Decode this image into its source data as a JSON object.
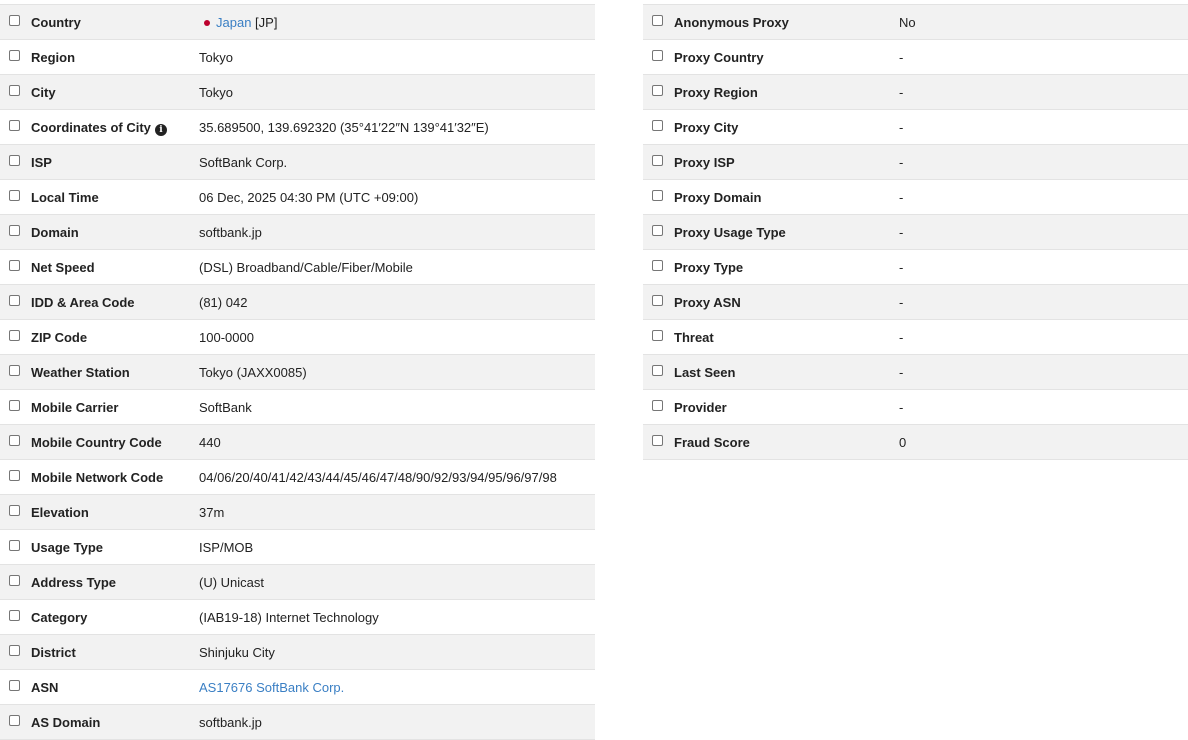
{
  "left_rows": [
    {
      "label": "Country",
      "value": "Japan",
      "suffix": " [JP]",
      "link": true,
      "flag": true
    },
    {
      "label": "Region",
      "value": "Tokyo"
    },
    {
      "label": "City",
      "value": "Tokyo"
    },
    {
      "label": "Coordinates of City",
      "value": "35.689500, 139.692320 (35°41′22″N   139°41′32″E)",
      "info": true
    },
    {
      "label": "ISP",
      "value": "SoftBank Corp."
    },
    {
      "label": "Local Time",
      "value": "06 Dec, 2025 04:30 PM (UTC +09:00)"
    },
    {
      "label": "Domain",
      "value": "softbank.jp"
    },
    {
      "label": "Net Speed",
      "value": "(DSL) Broadband/Cable/Fiber/Mobile"
    },
    {
      "label": "IDD & Area Code",
      "value": "(81) 042"
    },
    {
      "label": "ZIP Code",
      "value": "100-0000"
    },
    {
      "label": "Weather Station",
      "value": "Tokyo (JAXX0085)"
    },
    {
      "label": "Mobile Carrier",
      "value": "SoftBank"
    },
    {
      "label": "Mobile Country Code",
      "value": "440"
    },
    {
      "label": "Mobile Network Code",
      "value": "04/06/20/40/41/42/43/44/45/46/47/48/90/92/93/94/95/96/97/98"
    },
    {
      "label": "Elevation",
      "value": "37m"
    },
    {
      "label": "Usage Type",
      "value": "ISP/MOB"
    },
    {
      "label": "Address Type",
      "value": "(U) Unicast"
    },
    {
      "label": "Category",
      "value": "(IAB19-18) Internet Technology"
    },
    {
      "label": "District",
      "value": "Shinjuku City"
    },
    {
      "label": "ASN",
      "value": "AS17676 SoftBank Corp.",
      "link": true
    },
    {
      "label": "AS Domain",
      "value": "softbank.jp"
    }
  ],
  "right_rows": [
    {
      "label": "Anonymous Proxy",
      "value": "No"
    },
    {
      "label": "Proxy Country",
      "value": "-"
    },
    {
      "label": "Proxy Region",
      "value": "-"
    },
    {
      "label": "Proxy City",
      "value": "-"
    },
    {
      "label": "Proxy ISP",
      "value": "-"
    },
    {
      "label": "Proxy Domain",
      "value": "-"
    },
    {
      "label": "Proxy Usage Type",
      "value": "-"
    },
    {
      "label": "Proxy Type",
      "value": "-"
    },
    {
      "label": "Proxy ASN",
      "value": "-"
    },
    {
      "label": "Threat",
      "value": "-"
    },
    {
      "label": "Last Seen",
      "value": "-"
    },
    {
      "label": "Provider",
      "value": "-"
    },
    {
      "label": "Fraud Score",
      "value": "0"
    }
  ],
  "icons": {
    "info": "info-icon",
    "flag": "japan-flag-dot-icon"
  },
  "colors": {
    "link": "#3a7fc4",
    "shade": "#f2f2f2",
    "border": "#e3e3e3",
    "flag": "#bc002d"
  }
}
